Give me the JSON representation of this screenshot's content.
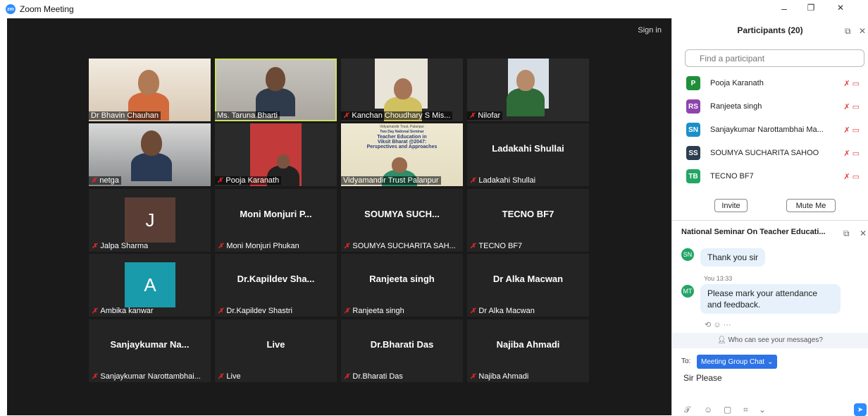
{
  "window": {
    "title": "Zoom Meeting",
    "minimize": "–",
    "restore": "❐",
    "close": "✕"
  },
  "stage": {
    "sign_in": "Sign in"
  },
  "tiles": [
    {
      "label": "Dr Bhavin Chauhan",
      "big": "",
      "muted": false
    },
    {
      "label": "Ms. Taruna Bharti",
      "big": "",
      "muted": false,
      "active": true
    },
    {
      "label": "Kanchan Choudhary S Mis...",
      "big": "",
      "muted": true
    },
    {
      "label": "Nilofar",
      "big": "",
      "muted": true
    },
    {
      "label": "netga",
      "big": "",
      "muted": true
    },
    {
      "label": "Pooja Karanath",
      "big": "",
      "muted": true
    },
    {
      "label": "Vidyamandir Trust Palanpur",
      "big": "",
      "muted": false
    },
    {
      "label": "Ladakahi Shullai",
      "big": "Ladakahi Shullai",
      "muted": true
    },
    {
      "label": "Jalpa Sharma",
      "big": "",
      "muted": true,
      "avatar": "J"
    },
    {
      "label": "Moni Monjuri Phukan",
      "big": "Moni Monjuri P...",
      "muted": true
    },
    {
      "label": "SOUMYA SUCHARITA SAH...",
      "big": "SOUMYA SUCH...",
      "muted": true
    },
    {
      "label": "TECNO BF7",
      "big": "TECNO BF7",
      "muted": true
    },
    {
      "label": "Ambika kanwar",
      "big": "",
      "muted": true,
      "avatar": "A"
    },
    {
      "label": "Dr.Kapildev Shastri",
      "big": "Dr.Kapildev Sha...",
      "muted": true
    },
    {
      "label": "Ranjeeta singh",
      "big": "Ranjeeta singh",
      "muted": true
    },
    {
      "label": "Dr Alka Macwan",
      "big": "Dr Alka Macwan",
      "muted": true
    },
    {
      "label": "Sanjaykumar Narottambhai...",
      "big": "Sanjaykumar Na...",
      "muted": true
    },
    {
      "label": "Live",
      "big": "Live",
      "muted": true
    },
    {
      "label": "Dr.Bharati Das",
      "big": "Dr.Bharati Das",
      "muted": true
    },
    {
      "label": "Najiba Ahmadi",
      "big": "Najiba Ahmadi",
      "muted": true
    }
  ],
  "slide": {
    "line1": "Vidyamandir Trust, Palanpur",
    "line2": "Two Day National Seminar",
    "line3": "Teacher Education in",
    "line4": "Viksit Bharat @2047:",
    "line5": "Perspectives and Approaches"
  },
  "participants_panel": {
    "title": "Participants (20)",
    "search_placeholder": "Find a participant",
    "participants": [
      {
        "initials": "P",
        "name": "Pooja Karanath",
        "color": "#1f8f3a"
      },
      {
        "initials": "RS",
        "name": "Ranjeeta singh",
        "color": "#8e44ad"
      },
      {
        "initials": "SN",
        "name": "Sanjaykumar Narottambhai Ma...",
        "color": "#1a8fc9"
      },
      {
        "initials": "SS",
        "name": "SOUMYA SUCHARITA SAHOO",
        "color": "#2c3e50"
      },
      {
        "initials": "TB",
        "name": "TECNO BF7",
        "color": "#23a566"
      }
    ],
    "invite": "Invite",
    "mute_me": "Mute Me"
  },
  "chat": {
    "title": "National Seminar On Teacher Educati...",
    "messages": [
      {
        "initials": "SN",
        "sender": "",
        "text": "Thank you sir"
      },
      {
        "initials": "MT",
        "sender": "You 13:33",
        "text_line1": "Please mark your attendance",
        "text_line2": "and feedback."
      }
    ],
    "who_can_see": "Who can see your messages?",
    "to_label": "To:",
    "recipient": "Meeting Group Chat",
    "draft": "Sir Please"
  },
  "colors": {
    "brand": "#2D8CFF",
    "active_speaker": "#c9e265",
    "muted": "#e02828"
  }
}
